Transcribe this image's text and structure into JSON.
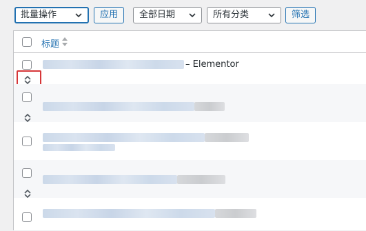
{
  "toolbar": {
    "bulk_actions": "批量操作",
    "apply": "应用",
    "date_filter": "全部日期",
    "category_filter": "所有分类",
    "filter": "筛选"
  },
  "table": {
    "column_title": "标题",
    "rows": [
      {
        "suffix": "– Elementor"
      },
      {
        "suffix": ""
      },
      {
        "suffix": ""
      },
      {
        "suffix": ""
      },
      {
        "suffix": ""
      }
    ]
  },
  "colors": {
    "accent": "#2271b1",
    "highlight": "#d63638"
  },
  "icons": {
    "select_arrow": "chevron-down-icon",
    "sort": "sort-arrows-icon",
    "reorder": "drag-handle-icon"
  }
}
